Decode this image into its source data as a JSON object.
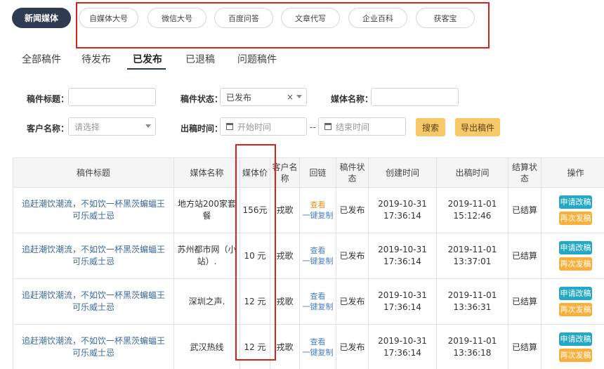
{
  "top_nav": {
    "active": "新闻媒体",
    "items": [
      "自媒体大号",
      "微信大号",
      "百度问答",
      "文章代写",
      "企业百科",
      "获客宝"
    ]
  },
  "tabs": [
    "全部稿件",
    "待发布",
    "已发布",
    "已退稿",
    "问题稿件"
  ],
  "filters": {
    "title_label": "稿件标题：",
    "status_label": "稿件状态：",
    "status_value": "已发布",
    "status_clear": "×",
    "media_label": "媒体名称：",
    "customer_label": "客户名称：",
    "customer_placeholder": "请选择",
    "time_label": "出稿时间：",
    "start_placeholder": "开始时间",
    "range_sep": "--",
    "end_placeholder": "结束时间",
    "search_label": "搜索",
    "export_label": "导出稿件"
  },
  "table": {
    "headers": [
      "稿件标题",
      "媒体名称",
      "媒体价",
      "客户名称",
      "回链",
      "稿件状态",
      "创建时间",
      "出稿时间",
      "结算状态",
      "操作"
    ],
    "link_view": "查看",
    "link_copy": "一键复制",
    "btn_apply": "申请改稿",
    "btn_resend": "再次发稿",
    "rows": [
      {
        "title": "追赶潮饮潮流，不如饮一杯黑茨蝙蝠王可乐威士忌",
        "media": "地方站200家套餐",
        "price": "156元",
        "customer": "戎歌",
        "status": "已发布",
        "created_date": "2019-10-31",
        "created_time": "17:36:14",
        "published_date": "2019-11-01",
        "published_time": "15:12:46",
        "settle": "已结算"
      },
      {
        "title": "追赶潮饮潮流，不如饮一杯黑茨蝙蝠王可乐威士忌",
        "media": "苏州都市网（小站）.",
        "price": "10 元",
        "customer": "戎歌",
        "status": "已发布",
        "created_date": "2019-10-31",
        "created_time": "17:36:14",
        "published_date": "2019-11-01",
        "published_time": "13:37:01",
        "settle": "已结算"
      },
      {
        "title": "追赶潮饮潮流，不如饮一杯黑茨蝙蝠王可乐威士忌",
        "media": "深圳之声.",
        "price": "12 元",
        "customer": "戎歌",
        "status": "已发布",
        "created_date": "2019-10-31",
        "created_time": "17:36:14",
        "published_date": "2019-11-01",
        "published_time": "13:36:31",
        "settle": "已结算"
      },
      {
        "title": "追赶潮饮潮流，不如饮一杯黑茨蝙蝠王可乐威士忌",
        "media": "武汉热线",
        "price": "12 元",
        "customer": "戎歌",
        "status": "已发布",
        "created_date": "2019-10-31",
        "created_time": "17:36:14",
        "published_date": "2019-11-01",
        "published_time": "13:36:18",
        "settle": "已结算"
      }
    ]
  },
  "colors": {
    "highlight_red": "#e02020",
    "nav_dark": "#2f3b52",
    "button_yellow": "#f8c96a",
    "op_teal": "#23a9c7",
    "op_orange": "#f8b03b"
  }
}
